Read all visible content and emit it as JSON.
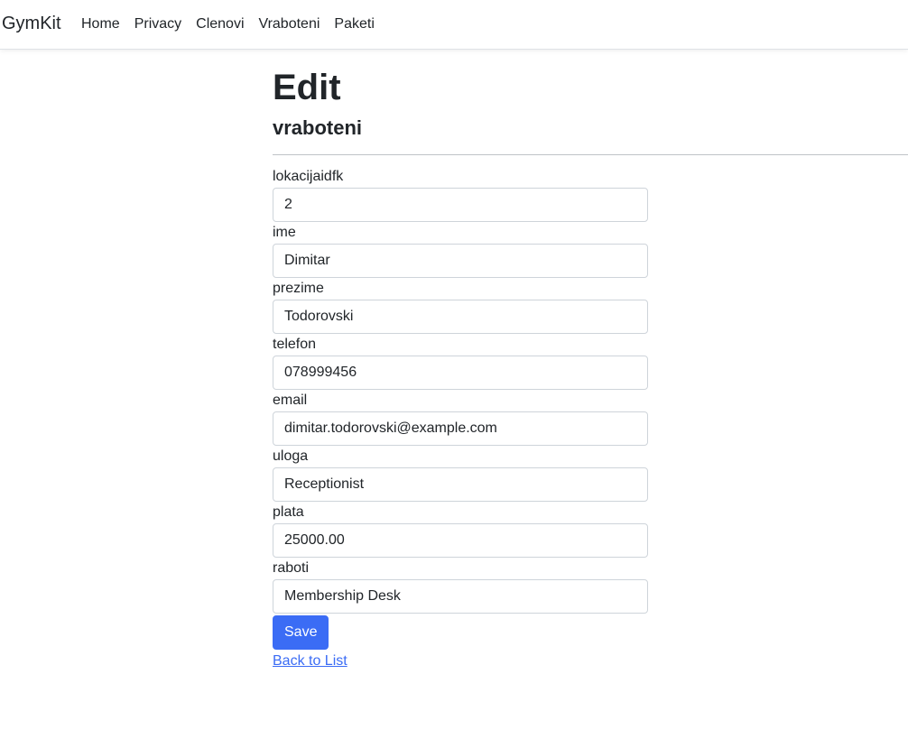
{
  "navbar": {
    "brand": "GymKit",
    "links": [
      "Home",
      "Privacy",
      "Clenovi",
      "Vraboteni",
      "Paketi"
    ]
  },
  "page": {
    "title": "Edit",
    "subtitle": "vraboteni"
  },
  "form": {
    "fields": [
      {
        "label": "lokacijaidfk",
        "value": "2"
      },
      {
        "label": "ime",
        "value": "Dimitar"
      },
      {
        "label": "prezime",
        "value": "Todorovski"
      },
      {
        "label": "telefon",
        "value": "078999456"
      },
      {
        "label": "email",
        "value": "dimitar.todorovski@example.com"
      },
      {
        "label": "uloga",
        "value": "Receptionist"
      },
      {
        "label": "plata",
        "value": "25000.00"
      },
      {
        "label": "raboti",
        "value": "Membership Desk"
      }
    ],
    "save_label": "Save",
    "back_label": "Back to List"
  },
  "colors": {
    "primary": "#3b6cf5",
    "text": "#212529",
    "border": "#ced4da"
  }
}
